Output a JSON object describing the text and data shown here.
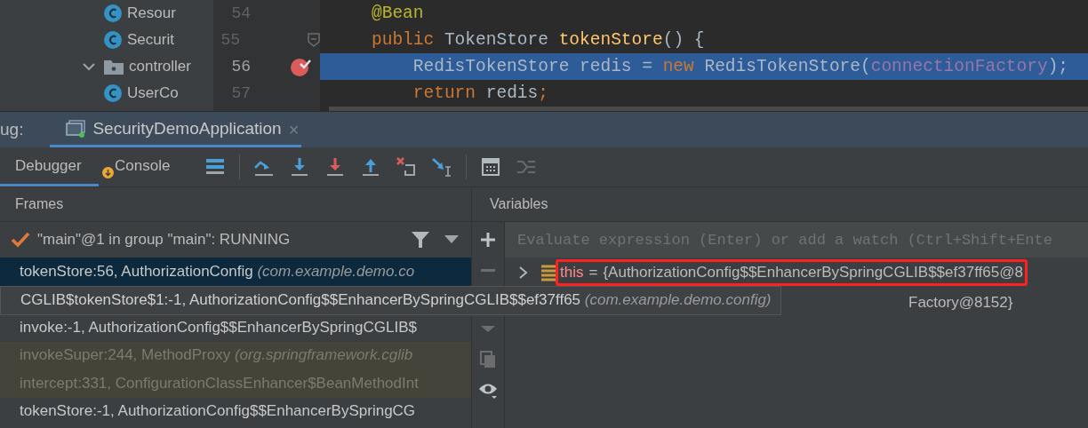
{
  "project_tree": [
    {
      "kind": "continuation",
      "children": [
        {
          "kind": "class",
          "label": "Resour"
        },
        {
          "kind": "class",
          "label": "Securit"
        }
      ]
    },
    {
      "kind": "folder",
      "label": "controller",
      "expanded": true,
      "children": [
        {
          "kind": "class",
          "label": "UserCo"
        }
      ]
    }
  ],
  "editor": {
    "lines": [
      {
        "number": "54",
        "selected": false,
        "breakpoint": false,
        "fold": false,
        "tokens": [
          {
            "kind": "annotation",
            "text": "@Bean"
          }
        ]
      },
      {
        "number": "55",
        "selected": false,
        "breakpoint": false,
        "fold": true,
        "tokens": [
          {
            "kind": "keyword",
            "text": "public "
          },
          {
            "kind": "plain",
            "text": "TokenStore "
          },
          {
            "kind": "method",
            "text": "tokenStore"
          },
          {
            "kind": "plain",
            "text": "() {"
          }
        ]
      },
      {
        "number": "56",
        "selected": true,
        "breakpoint": true,
        "fold": false,
        "tokens": [
          {
            "kind": "plain",
            "text": "    RedisTokenStore redis = "
          },
          {
            "kind": "keyword",
            "text": "new "
          },
          {
            "kind": "plain",
            "text": "RedisTokenStore("
          },
          {
            "kind": "field",
            "text": "connectionFactory"
          },
          {
            "kind": "plain",
            "text": ");"
          }
        ]
      },
      {
        "number": "57",
        "selected": false,
        "breakpoint": false,
        "fold": false,
        "tokens": [
          {
            "kind": "keyword",
            "text": "    return "
          },
          {
            "kind": "plain",
            "text": "redis"
          },
          {
            "kind": "keyword",
            "text": ";"
          }
        ]
      }
    ]
  },
  "debug": {
    "label": "ug:",
    "session_tab": {
      "title": "SecurityDemoApplication",
      "close": "×",
      "selected": true
    },
    "tabs": [
      {
        "label": "Debugger",
        "selected": true,
        "badge": false
      },
      {
        "label": "Console",
        "selected": false,
        "badge": true
      }
    ],
    "toolbar": [
      {
        "kind": "layout",
        "disabled": false
      },
      {
        "kind": "separator"
      },
      {
        "kind": "step-over",
        "disabled": false
      },
      {
        "kind": "step-into",
        "disabled": false
      },
      {
        "kind": "force-step-into",
        "disabled": false
      },
      {
        "kind": "step-out",
        "disabled": false
      },
      {
        "kind": "drop-frame",
        "disabled": false
      },
      {
        "kind": "run-to-cursor",
        "disabled": false
      },
      {
        "kind": "separator"
      },
      {
        "kind": "evaluate",
        "disabled": false
      },
      {
        "kind": "trace",
        "disabled": true
      }
    ]
  },
  "frames": {
    "title": "Frames",
    "thread": "\"main\"@1 in group \"main\": RUNNING",
    "items": [
      {
        "name": "tokenStore:56, AuthorizationConfig",
        "package": "(com.example.demo.co",
        "selected": true,
        "library": false,
        "tooltip": false
      },
      {
        "name": "CGLIB$tokenStore$1:-1, AuthorizationConfig$$EnhancerBySpringCGLIB$$ef37ff65",
        "package": "(com.example.demo.config)",
        "selected": false,
        "library": false,
        "tooltip": true
      },
      {
        "name": "invoke:-1, AuthorizationConfig$$EnhancerBySpringCGLIB$",
        "selected": false,
        "library": false,
        "tooltip": false
      },
      {
        "name": "invokeSuper:244, MethodProxy",
        "package": "(org.springframework.cglib",
        "selected": false,
        "library": true,
        "tooltip": false
      },
      {
        "name": "intercept:331, ConfigurationClassEnhancer$BeanMethodInt",
        "selected": false,
        "library": true,
        "tooltip": false
      },
      {
        "name": "tokenStore:-1, AuthorizationConfig$$EnhancerBySpringCG",
        "selected": false,
        "library": false,
        "tooltip": false
      }
    ]
  },
  "side_toolbar": [
    {
      "kind": "add",
      "disabled": false
    },
    {
      "kind": "remove",
      "disabled": true
    },
    {
      "kind": "move-down",
      "disabled": true
    },
    {
      "kind": "copy",
      "disabled": true
    },
    {
      "kind": "watch",
      "disabled": false
    }
  ],
  "variables": {
    "title": "Variables",
    "watch_placeholder": "Evaluate expression (Enter) or add a watch (Ctrl+Shift+Ente",
    "items": [
      {
        "name": "this",
        "separator": "=",
        "value": "{AuthorizationConfig$$EnhancerBySpringCGLIB$$ef37ff65@8",
        "expandable": true,
        "highlighted": true
      },
      {
        "value": "Factory@8152}",
        "expandable": false,
        "highlighted": false
      }
    ]
  }
}
